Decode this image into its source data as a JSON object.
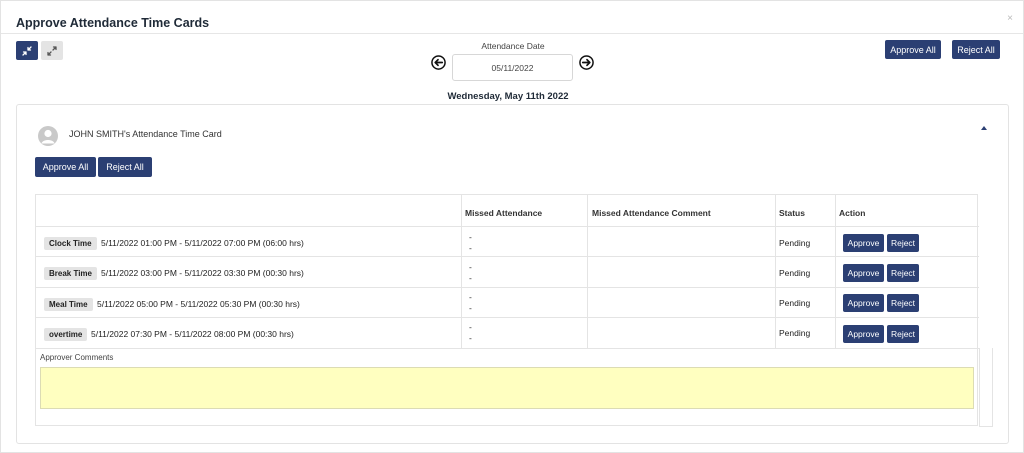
{
  "modal": {
    "title": "Approve Attendance Time Cards",
    "close_label": "×"
  },
  "toolbar": {
    "collapse_icon": "collapse-arrows-icon",
    "expand_icon": "expand-arrows-icon",
    "approve_all_label": "Approve All",
    "reject_all_label": "Reject All"
  },
  "date_picker": {
    "label": "Attendance Date",
    "value": "05/11/2022",
    "day_label": "Wednesday, May 11th 2022",
    "prev_icon": "arrow-left-circle-icon",
    "next_icon": "arrow-right-circle-icon"
  },
  "time_card": {
    "title": "JOHN SMITH's Attendance Time Card",
    "approve_all_label": "Approve All",
    "reject_all_label": "Reject All",
    "columns": {
      "missed_attendance": "Missed Attendance",
      "missed_comment": "Missed Attendance Comment",
      "status": "Status",
      "action": "Action"
    },
    "rows": [
      {
        "type": "Clock Time",
        "range": "5/11/2022 01:00 PM - 5/11/2022 07:00 PM (06:00 hrs)",
        "missed_line1": "-",
        "missed_line2": "-",
        "comment": "",
        "status": "Pending",
        "approve_label": "Approve",
        "reject_label": "Reject"
      },
      {
        "type": "Break Time",
        "range": "5/11/2022 03:00 PM - 5/11/2022 03:30 PM (00:30 hrs)",
        "missed_line1": "-",
        "missed_line2": "-",
        "comment": "",
        "status": "Pending",
        "approve_label": "Approve",
        "reject_label": "Reject"
      },
      {
        "type": "Meal Time",
        "range": "5/11/2022 05:00 PM - 5/11/2022 05:30 PM (00:30 hrs)",
        "missed_line1": "-",
        "missed_line2": "-",
        "comment": "",
        "status": "Pending",
        "approve_label": "Approve",
        "reject_label": "Reject"
      },
      {
        "type": "overtime",
        "range": "5/11/2022 07:30 PM - 5/11/2022 08:00 PM (00:30 hrs)",
        "missed_line1": "-",
        "missed_line2": "-",
        "comment": "",
        "status": "Pending",
        "approve_label": "Approve",
        "reject_label": "Reject"
      }
    ],
    "approver_comments_label": "Approver Comments",
    "approver_comments_value": ""
  },
  "colors": {
    "primary": "#2b3f73",
    "comment_box": "#ffffc0",
    "tag_bg": "#e4e4e4"
  }
}
